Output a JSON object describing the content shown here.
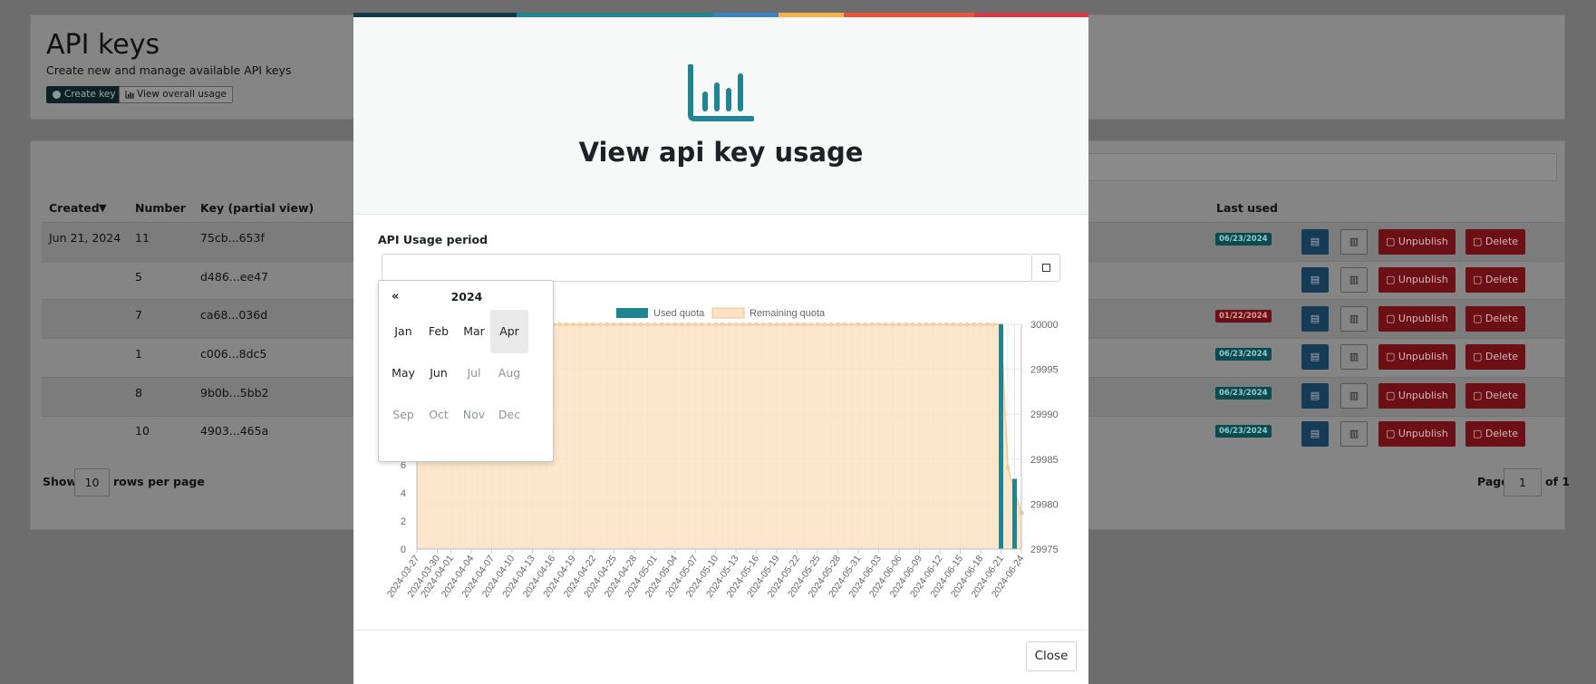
{
  "page": {
    "title": "API keys",
    "subtitle": "Create new and manage available API keys",
    "create_label": "Create key",
    "usage_label": "View overall usage"
  },
  "table": {
    "headers": {
      "created": "Created",
      "sort_icon": "▼",
      "number": "Number",
      "key": "Key (partial view)",
      "last_used": "Last used"
    },
    "rows": [
      {
        "created": "Jun 21, 2024",
        "number": "11",
        "key": "75cb...653f",
        "last_used": "06/23/2024",
        "badge": "teal"
      },
      {
        "created": "",
        "number": "5",
        "key": "d486...ee47",
        "last_used": "",
        "badge": ""
      },
      {
        "created": "",
        "number": "7",
        "key": "ca68...036d",
        "last_used": "01/22/2024",
        "badge": "red"
      },
      {
        "created": "",
        "number": "1",
        "key": "c006...8dc5",
        "last_used": "06/23/2024",
        "badge": "teal"
      },
      {
        "created": "",
        "number": "8",
        "key": "9b0b...5bb2",
        "last_used": "06/23/2024",
        "badge": "teal"
      },
      {
        "created": "",
        "number": "10",
        "key": "4903...465a",
        "last_used": "06/23/2024",
        "badge": "teal"
      }
    ],
    "actions": {
      "unpublish": "Unpublish",
      "delete": "Delete"
    },
    "footer": {
      "show": "Show",
      "rows_value": "10",
      "rows_per_page": "rows per page",
      "page": "Page",
      "page_value": "1",
      "of": "of 1"
    }
  },
  "modal": {
    "title": "View api key usage",
    "period_label": "API Usage period",
    "close_label": "Close",
    "accent_colors": [
      "#123a49",
      "#1f8593",
      "#3a7fc0",
      "#f6b24a",
      "#e9533a",
      "#d13c45"
    ]
  },
  "picker": {
    "prev": "«",
    "year": "2024",
    "months": [
      {
        "label": "Jan",
        "state": "normal"
      },
      {
        "label": "Feb",
        "state": "normal"
      },
      {
        "label": "Mar",
        "state": "normal"
      },
      {
        "label": "Apr",
        "state": "selected"
      },
      {
        "label": "May",
        "state": "normal"
      },
      {
        "label": "Jun",
        "state": "normal"
      },
      {
        "label": "Jul",
        "state": "disabled"
      },
      {
        "label": "Aug",
        "state": "disabled"
      },
      {
        "label": "Sep",
        "state": "disabled"
      },
      {
        "label": "Oct",
        "state": "disabled"
      },
      {
        "label": "Nov",
        "state": "disabled"
      },
      {
        "label": "Dec",
        "state": "disabled"
      }
    ]
  },
  "chart_data": {
    "type": "bar",
    "legend_position": "top",
    "grid": true,
    "x_labels": [
      "2024-03-27",
      "2024-03-30",
      "2024-04-01",
      "2024-04-04",
      "2024-04-07",
      "2024-04-10",
      "2024-04-13",
      "2024-04-16",
      "2024-04-19",
      "2024-04-22",
      "2024-04-25",
      "2024-04-28",
      "2024-05-01",
      "2024-05-04",
      "2024-05-07",
      "2024-05-10",
      "2024-05-13",
      "2024-05-16",
      "2024-05-19",
      "2024-05-22",
      "2024-05-25",
      "2024-05-28",
      "2024-05-31",
      "2024-06-03",
      "2024-06-06",
      "2024-06-09",
      "2024-06-12",
      "2024-06-15",
      "2024-06-18",
      "2024-06-21",
      "2024-06-24"
    ],
    "series": [
      {
        "name": "Used quota",
        "axis": "left",
        "color": "#1f8593",
        "points": [
          {
            "x": "2024-06-21",
            "y": 16
          },
          {
            "x": "2024-06-23",
            "y": 5
          }
        ]
      },
      {
        "name": "Remaining quota",
        "axis": "right",
        "color": "#fbe3c3",
        "baseline": 30000,
        "points": [
          {
            "x": "2024-06-21",
            "y": 30000
          },
          {
            "x": "2024-06-22",
            "y": 29984
          },
          {
            "x": "2024-06-24",
            "y": 29979
          }
        ]
      }
    ],
    "y_left": {
      "ticks": [
        0,
        2,
        4,
        6
      ],
      "range": [
        0,
        16
      ]
    },
    "y_right": {
      "ticks": [
        29975,
        29980,
        29985,
        29990,
        29995,
        30000
      ],
      "range": [
        29975,
        30000
      ]
    }
  }
}
